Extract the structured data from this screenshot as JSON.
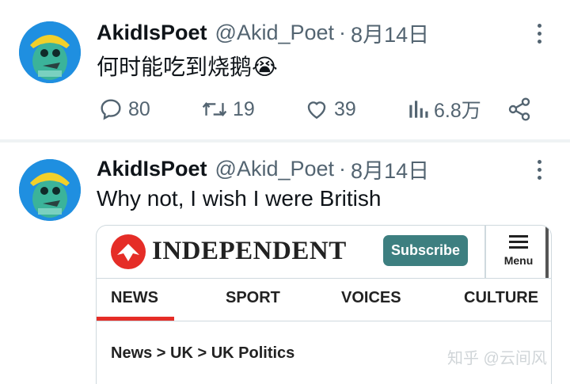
{
  "tweets": [
    {
      "name": "AkidIsPoet",
      "handle": "@Akid_Poet",
      "separator": "·",
      "date": "8月14日",
      "text": "何时能吃到烧鹅😭",
      "actions": {
        "replies": "80",
        "retweets": "19",
        "likes": "39",
        "views": "6.8万"
      }
    },
    {
      "name": "AkidIsPoet",
      "handle": "@Akid_Poet",
      "separator": "·",
      "date": "8月14日",
      "text": "Why not, I wish I were British",
      "card": {
        "masthead": "INDEPENDENT",
        "subscribe": "Subscribe",
        "menu": "Menu",
        "nav": [
          "NEWS",
          "SPORT",
          "VOICES",
          "CULTURE"
        ],
        "breadcrumb": "News > UK > UK Politics"
      }
    }
  ],
  "watermark": "知乎 @云间风",
  "colors": {
    "muted": "#536471",
    "independent_red": "#e52d27",
    "subscribe_teal": "#3d7f80"
  }
}
